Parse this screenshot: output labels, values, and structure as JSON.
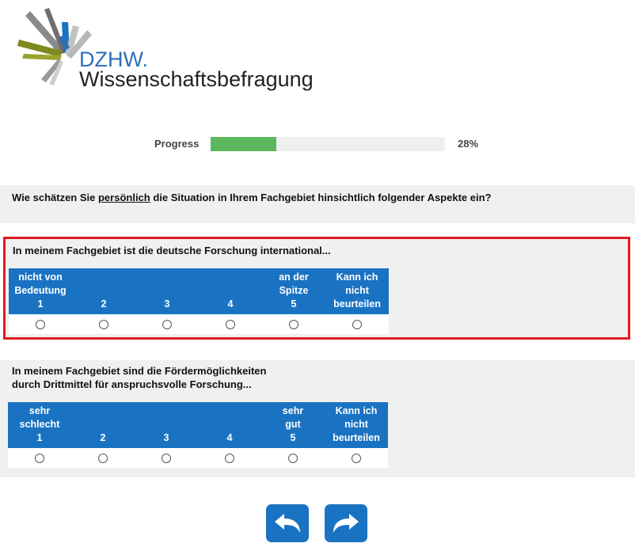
{
  "brand": {
    "top": "DZHW.",
    "bottom": "Wissenschaftsbefragung"
  },
  "progress": {
    "label": "Progress",
    "value_text": "28%",
    "fraction": 0.28
  },
  "question": {
    "prefix": "Wie schätzen Sie ",
    "emphasis": "persönlich",
    "suffix": " die Situation in Ihrem Fachgebiet hinsichtlich folgender Aspekte ein?"
  },
  "items": [
    {
      "title_line1": "In meinem Fachgebiet ist die deutsche Forschung international...",
      "title_line2": "",
      "columns": [
        {
          "lines": [
            "nicht von",
            "Bedeutung",
            "1"
          ]
        },
        {
          "lines": [
            "2"
          ]
        },
        {
          "lines": [
            "3"
          ]
        },
        {
          "lines": [
            "4"
          ]
        },
        {
          "lines": [
            "an der",
            "Spitze",
            "5"
          ]
        },
        {
          "lines": [
            "Kann ich",
            "nicht",
            "beurteilen"
          ]
        }
      ]
    },
    {
      "title_line1": "In meinem Fachgebiet sind die Fördermöglichkeiten",
      "title_line2": "durch Drittmittel für anspruchsvolle Forschung...",
      "columns": [
        {
          "lines": [
            "sehr",
            "schlecht",
            "1"
          ]
        },
        {
          "lines": [
            "2"
          ]
        },
        {
          "lines": [
            "3"
          ]
        },
        {
          "lines": [
            "4"
          ]
        },
        {
          "lines": [
            "sehr",
            "gut",
            "5"
          ]
        },
        {
          "lines": [
            "Kann ich",
            "nicht",
            "beurteilen"
          ]
        }
      ]
    }
  ],
  "navigation": {
    "back_icon": "back-arrow-icon",
    "forward_icon": "forward-arrow-icon",
    "color": "#1a73c2"
  },
  "colors": {
    "accent": "#1a73c2",
    "progress": "#5cb85c",
    "highlight": "#e11b22"
  }
}
